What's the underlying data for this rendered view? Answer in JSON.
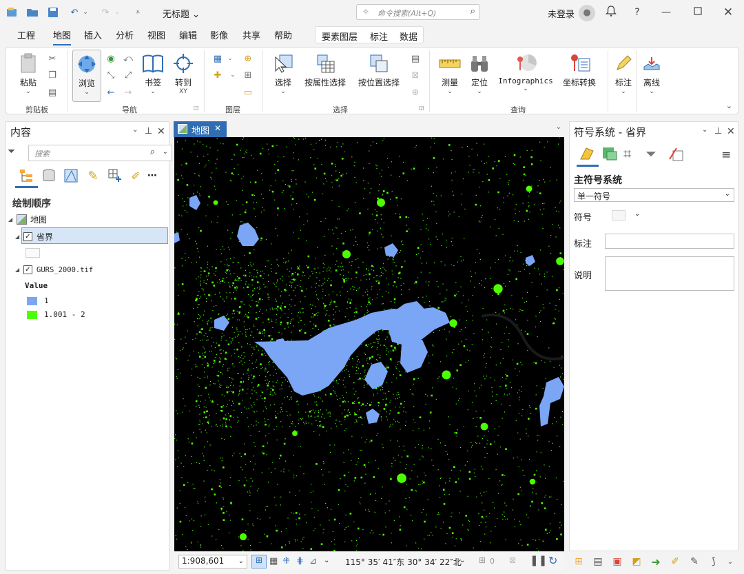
{
  "titlebar": {
    "doc_title": "无标题 ⌄",
    "command_search_placeholder": "命令搜索(Alt+Q)",
    "login_label": "未登录",
    "help": "?"
  },
  "menu": {
    "tabs": [
      "工程",
      "地图",
      "插入",
      "分析",
      "视图",
      "编辑",
      "影像",
      "共享",
      "帮助"
    ],
    "active": "地图",
    "contextual_tabs": [
      "要素图层",
      "标注",
      "数据"
    ]
  },
  "ribbon": {
    "paste": "粘贴",
    "clipboard_group": "剪贴板",
    "explore": "浏览",
    "bookmarks": "书签",
    "goto_xy": "转到",
    "goto_xy_sub": "XY",
    "navigate_group": "导航",
    "layer_group": "图层",
    "select": "选择",
    "select_by_attr": "按属性选择",
    "select_by_loc": "按位置选择",
    "selection_group": "选择",
    "measure": "测量",
    "locate": "定位",
    "infographics": "Infographics",
    "convert_coords": "坐标转换",
    "inquiry_group": "查询",
    "label": "标注",
    "offline": "离线"
  },
  "contents": {
    "title": "内容",
    "search_placeholder": "搜索",
    "draw_order": "绘制顺序",
    "map_name": "地图",
    "layer1": "省界",
    "layer2": "GURS_2000.tif",
    "legend_title": "Value",
    "legend": [
      {
        "label": "1",
        "color": "#7aa6f5"
      },
      {
        "label": "1.001 - 2",
        "color": "#4cff00"
      }
    ]
  },
  "map": {
    "tab_label": "地图",
    "scale": "1:908,601",
    "coordinates": "115° 35′ 41″东  30° 34′ 22″北",
    "selected_count": "0",
    "urban_color": "#7aa6f5",
    "vegetation_color": "#4cff00"
  },
  "symbology": {
    "title": "符号系统 - 省界",
    "primary_label": "主符号系统",
    "primary_value": "单一符号",
    "symbol_label": "符号",
    "label_label": "标注",
    "description_label": "说明"
  }
}
